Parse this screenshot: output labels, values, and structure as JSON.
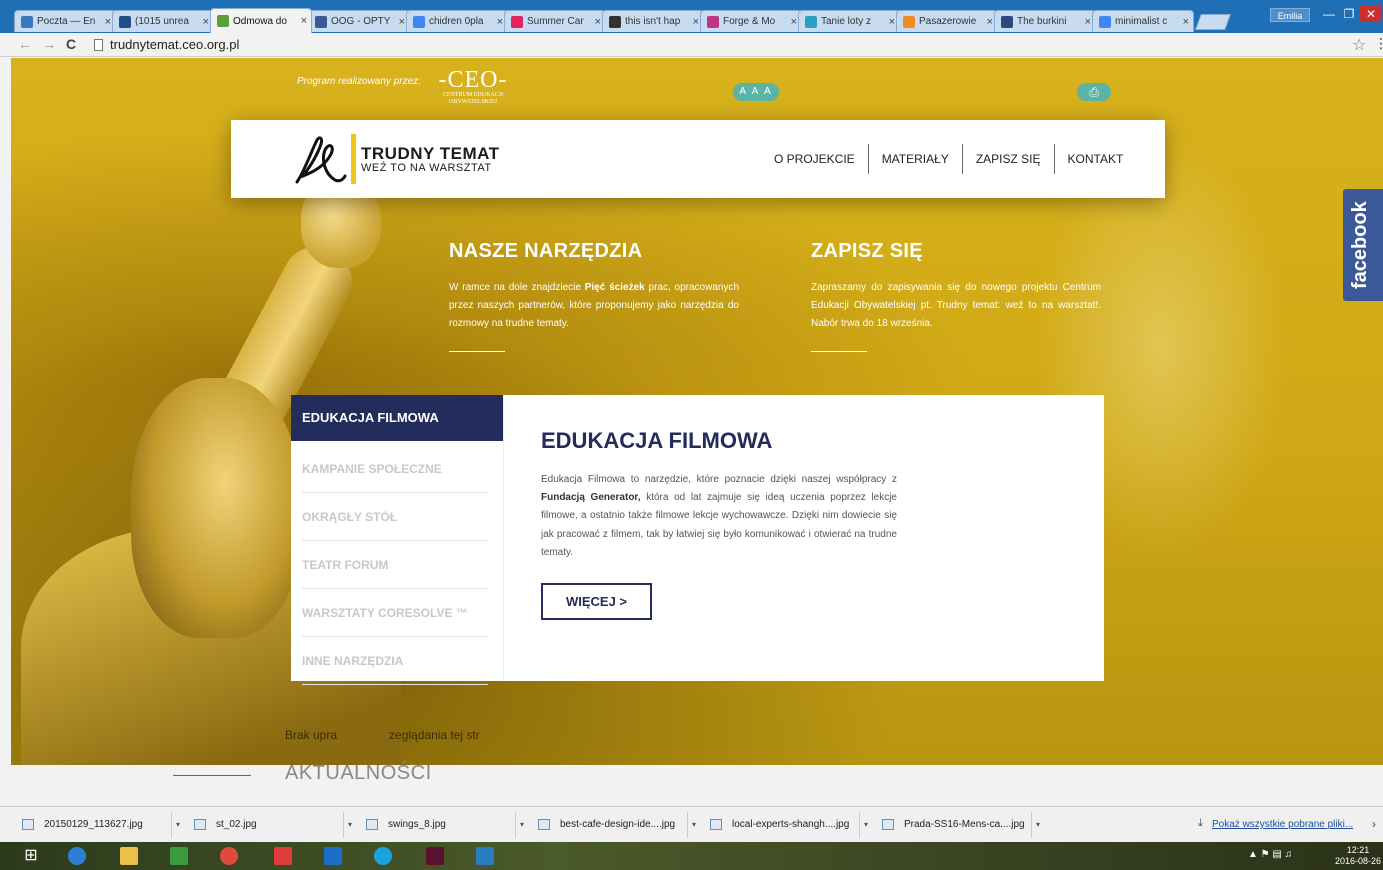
{
  "browser": {
    "tabs": [
      {
        "label": "Poczta — En",
        "icon_color": "#3a78c3",
        "active": false
      },
      {
        "label": "(1015 unrea",
        "icon_color": "#1f4f8a",
        "active": false
      },
      {
        "label": "Odmowa do",
        "icon_color": "#5b9f3a",
        "active": true
      },
      {
        "label": "OOG - OPTY",
        "icon_color": "#3b5998",
        "active": false
      },
      {
        "label": "chidren 0pla",
        "icon_color": "#4285f4",
        "active": false
      },
      {
        "label": "Summer Car",
        "icon_color": "#e0245e",
        "active": false
      },
      {
        "label": "this isn't hap",
        "icon_color": "#333333",
        "active": false
      },
      {
        "label": "Forge & Mo",
        "icon_color": "#c13584",
        "active": false
      },
      {
        "label": "Tanie loty z",
        "icon_color": "#2aa1c0",
        "active": false
      },
      {
        "label": "Pasazerowie",
        "icon_color": "#f08a24",
        "active": false
      },
      {
        "label": "The burkini",
        "icon_color": "#2a4b7c",
        "active": false
      },
      {
        "label": "minimalist c",
        "icon_color": "#4285f4",
        "active": false
      }
    ],
    "profile": "Emilia",
    "url": "trudnytemat.ceo.org.pl"
  },
  "page": {
    "program_label": "Program realizowany przez:",
    "ceo_logo": "-CEO-",
    "ceo_subtitle_1": "CENTRUM EDUKACJI",
    "ceo_subtitle_2": "OBYWATELSKIEJ",
    "font_size_toggle": "A A A",
    "header": {
      "title": "TRUDNY TEMAT",
      "subtitle": "WEŹ TO NA WARSZTAT",
      "nav": [
        "O PROJEKCIE",
        "MATERIAŁY",
        "ZAPISZ SIĘ",
        "KONTAKT"
      ]
    },
    "tools_section": {
      "title": "NASZE NARZĘDZIA",
      "text_1": "W ramce na dole znajdziecie",
      "text_bold": "Pięć ścieżek",
      "text_2": "prac, opracowanych przez naszych partnerów, które proponujemy jako narzędzia do rozmowy na trudne tematy."
    },
    "signup_section": {
      "title": "ZAPISZ SIĘ",
      "text": "Zapraszamy do zapisywania się do nowego projektu Centrum Edukacji Obywatelskiej pt. Trudny temat: weź to na warsztat!. Nabór trwa do 18 września."
    },
    "facebook_label": "facebook",
    "tool_list": [
      "EDUKACJA FILMOWA",
      "KAMPANIE SPOŁECZNE",
      "OKRĄGŁY STÓŁ",
      "TEATR FORUM",
      "WARSZTATY CORESOLVE ™",
      "INNE NARZĘDZIA"
    ],
    "panel": {
      "title": "EDUKACJA FILMOWA",
      "text_1": "Edukacja Filmowa to narzędzie, które poznacie dzięki naszej współpracy z",
      "text_bold": "Fundacją Generator,",
      "text_2": "która od lat zajmuje się ideą uczenia poprzez lekcje filmowe, a ostatnio także filmowe lekcje wychowawcze. Dzięki nim dowiecie się jak pracować z filmem, tak by łatwiej się było komunikować i otwierać na trudne tematy.",
      "button": "WIĘCEJ >"
    },
    "no_access": "Brak upra",
    "no_access_tail": "zeglądania tej str",
    "news_heading": "AKTUALNOŚCI"
  },
  "downloads": {
    "files": [
      "20150129_113627.jpg",
      "st_02.jpg",
      "swings_8.jpg",
      "best-cafe-design-ide....jpg",
      "local-experts-shangh....jpg",
      "Prada-SS16-Mens-ca....jpg"
    ],
    "show_all": "Pokaż wszystkie pobrane pliki..."
  },
  "taskbar": {
    "time": "12:21",
    "date": "2016-08-26"
  }
}
